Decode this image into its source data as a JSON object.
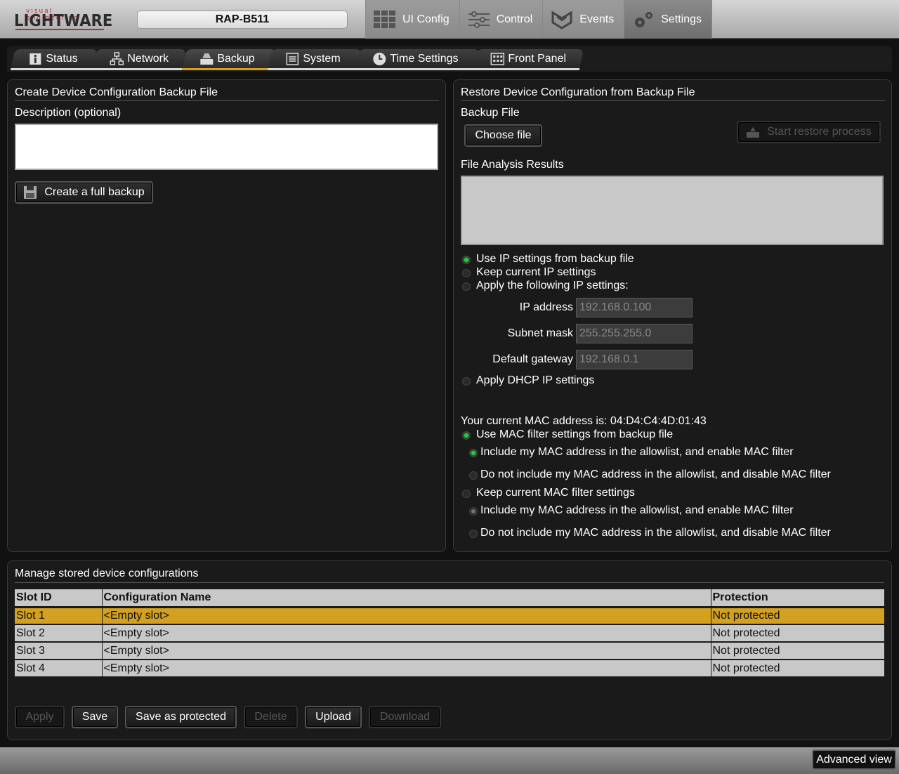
{
  "brand": {
    "tagline": "visual engineering",
    "name": "LIGHTWARE"
  },
  "device_name": "RAP-B511",
  "top_nav": [
    {
      "label": "UI Config",
      "icon": "grid-icon"
    },
    {
      "label": "Control",
      "icon": "sliders-icon"
    },
    {
      "label": "Events",
      "icon": "events-icon"
    },
    {
      "label": "Settings",
      "icon": "gears-icon",
      "active": true
    }
  ],
  "sub_tabs": [
    {
      "label": "Status",
      "icon": "info-icon"
    },
    {
      "label": "Network",
      "icon": "network-icon"
    },
    {
      "label": "Backup",
      "icon": "backup-icon",
      "active": true
    },
    {
      "label": "System",
      "icon": "system-icon"
    },
    {
      "label": "Time Settings",
      "icon": "clock-icon"
    },
    {
      "label": "Front Panel",
      "icon": "front-panel-icon"
    }
  ],
  "create": {
    "title": "Create Device Configuration Backup File",
    "description_label": "Description (optional)",
    "description_value": "",
    "create_button": "Create a full backup"
  },
  "restore": {
    "title": "Restore Device Configuration from Backup File",
    "backup_file_label": "Backup File",
    "choose_file": "Choose file",
    "start_restore": "Start restore process",
    "analysis_label": "File Analysis Results",
    "ip_options": {
      "use_backup": "Use IP settings from backup file",
      "keep_current": "Keep current IP settings",
      "apply_following": "Apply the following IP settings:",
      "apply_dhcp": "Apply DHCP IP settings"
    },
    "ip_fields": {
      "ip_label": "IP address",
      "ip_value": "192.168.0.100",
      "mask_label": "Subnet mask",
      "mask_value": "255.255.255.0",
      "gateway_label": "Default gateway",
      "gateway_value": "192.168.0.1"
    },
    "mac_text": "Your current MAC address is: 04:D4:C4:4D:01:43",
    "mac_options": {
      "use_backup": "Use MAC filter settings from backup file",
      "include_1": "Include my MAC address in the allowlist, and enable MAC filter",
      "exclude_1": "Do not include my MAC address in the allowlist, and disable MAC filter",
      "keep_current": "Keep current MAC filter settings",
      "include_2": "Include my MAC address in the allowlist, and enable MAC filter",
      "exclude_2": "Do not include my MAC address in the allowlist, and disable MAC filter"
    }
  },
  "manage": {
    "title": "Manage stored device configurations",
    "columns": [
      "Slot ID",
      "Configuration Name",
      "Protection"
    ],
    "rows": [
      [
        "Slot 1",
        "<Empty slot>",
        "Not protected"
      ],
      [
        "Slot 2",
        "<Empty slot>",
        "Not protected"
      ],
      [
        "Slot 3",
        "<Empty slot>",
        "Not protected"
      ],
      [
        "Slot 4",
        "<Empty slot>",
        "Not protected"
      ]
    ],
    "buttons": {
      "apply": "Apply",
      "save": "Save",
      "save_protected": "Save as protected",
      "delete": "Delete",
      "upload": "Upload",
      "download": "Download"
    }
  },
  "advanced_view": "Advanced view",
  "colors": {
    "accent": "#d4a020",
    "radio_on": "#27c94a",
    "brand_red": "#c0272d"
  }
}
